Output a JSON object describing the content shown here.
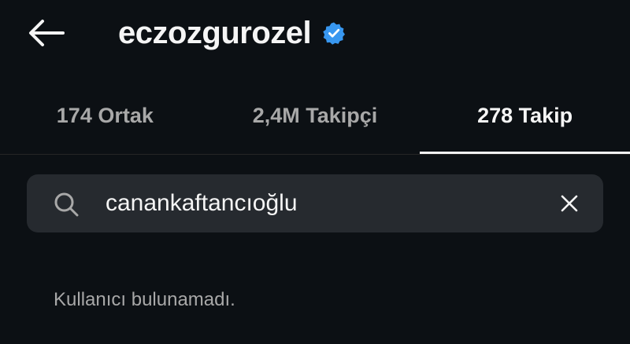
{
  "header": {
    "back_icon": "arrow-left-icon",
    "username": "eczozgurozel",
    "verified_icon": "verified-badge-icon",
    "verified_color": "#3897f0"
  },
  "tabs": [
    {
      "label": "174 Ortak",
      "active": false
    },
    {
      "label": "2,4M Takipçi",
      "active": false
    },
    {
      "label": "278 Takip",
      "active": true
    }
  ],
  "search": {
    "icon": "search-icon",
    "value": "canankaftancıoğlu",
    "clear_icon": "close-icon"
  },
  "results": {
    "empty_message": "Kullanıcı bulunamadı."
  },
  "colors": {
    "background": "#0c1014",
    "text_primary": "#f5f5f5",
    "text_secondary": "#a8a8a8",
    "search_background": "#262a2f"
  }
}
